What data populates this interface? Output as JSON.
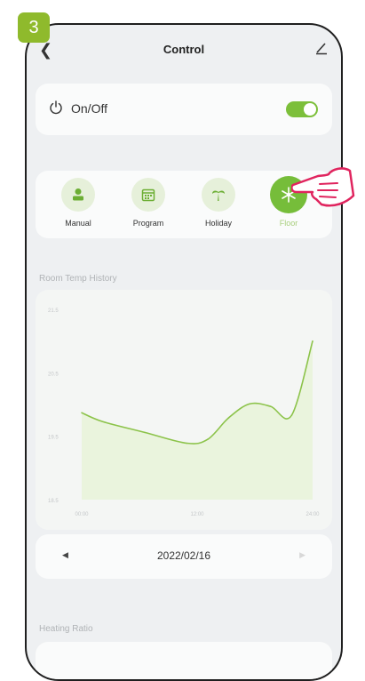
{
  "step": {
    "number": "3"
  },
  "header": {
    "back_icon": "chevron-left-icon",
    "title": "Control",
    "edit_icon": "pencil-icon"
  },
  "power": {
    "label": "On/Off",
    "state": "on",
    "icon": "power-icon",
    "accent": "#7cbf3a"
  },
  "modes": [
    {
      "label": "Manual",
      "icon": "person-icon",
      "active": false
    },
    {
      "label": "Program",
      "icon": "calendar-icon",
      "active": false
    },
    {
      "label": "Holiday",
      "icon": "palm-tree-icon",
      "active": false
    },
    {
      "label": "Floor",
      "icon": "snowflake-icon",
      "active": true
    }
  ],
  "history": {
    "title": "Room Temp History"
  },
  "chart_data": {
    "type": "area",
    "title": "Room Temp History",
    "y_ticks": [
      "21.5",
      "20.5",
      "19.5",
      "18.5"
    ],
    "ylim": [
      18.5,
      21.5
    ],
    "x_ticks": [
      "00:00",
      "12:00",
      "24:00"
    ],
    "series": [
      {
        "x": [
          0,
          1,
          3,
          5,
          6,
          7,
          8,
          9,
          10,
          11
        ],
        "values": [
          19.87,
          19.73,
          19.56,
          19.39,
          19.45,
          19.79,
          20.01,
          19.97,
          19.83,
          21.0
        ]
      }
    ],
    "grid": false,
    "line_color": "#8cc34a",
    "fill_color": "#eaf4dd"
  },
  "date_nav": {
    "prev_icon": "caret-left-icon",
    "date": "2022/02/16",
    "next_icon": "caret-right-icon"
  },
  "heating": {
    "title": "Heating Ratio"
  }
}
